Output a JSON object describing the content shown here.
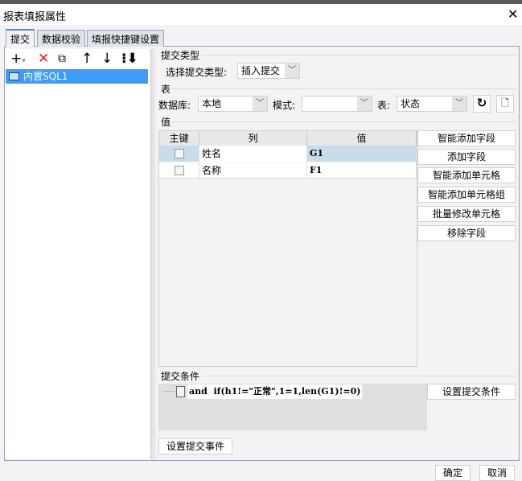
{
  "window": {
    "title": "报表填报属性"
  },
  "tabs": [
    "提交",
    "数据校验",
    "填报快捷键设置"
  ],
  "left": {
    "items": [
      "内置SQL1"
    ]
  },
  "submit_type": {
    "section": "提交类型",
    "label": "选择提交类型:",
    "value": "插入提交"
  },
  "table_section": {
    "section": "表",
    "db_label": "数据库:",
    "db_value": "本地",
    "schema_label": "模式:",
    "schema_value": "",
    "table_label": "表:",
    "table_value": "状态"
  },
  "values": {
    "section": "值",
    "headers": [
      "主键",
      "列",
      "值"
    ],
    "rows": [
      {
        "column": "姓名",
        "value": "G1"
      },
      {
        "column": "名称",
        "value": "F1"
      }
    ],
    "buttons": [
      "智能添加字段",
      "添加字段",
      "智能添加单元格",
      "智能添加单元格组",
      "批量修改单元格",
      "移除字段"
    ]
  },
  "condition": {
    "section": "提交条件",
    "text": "and  if(h1!=\"正常\",1=1,len(G1)!=0)",
    "button": "设置提交条件"
  },
  "event_button": "设置提交事件",
  "footer": {
    "ok": "确定",
    "cancel": "取消"
  }
}
